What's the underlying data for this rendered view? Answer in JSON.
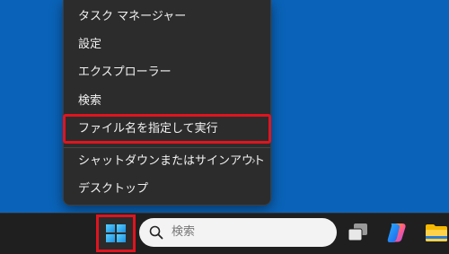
{
  "context_menu": {
    "items": [
      {
        "label": "タスク マネージャー"
      },
      {
        "label": "設定"
      },
      {
        "label": "エクスプローラー"
      },
      {
        "label": "検索"
      },
      {
        "label": "ファイル名を指定して実行"
      },
      {
        "label": "シャットダウンまたはサインアウト",
        "submenu_arrow": "›"
      },
      {
        "label": "デスクトップ"
      }
    ]
  },
  "taskbar": {
    "start_button": {
      "icon": "windows-logo-icon"
    },
    "search": {
      "placeholder": "検索",
      "icon": "search-icon"
    },
    "pinned": [
      {
        "icon": "task-view-icon"
      },
      {
        "icon": "copilot-icon"
      },
      {
        "icon": "file-explorer-icon"
      }
    ]
  },
  "colors": {
    "desktop": "#0a63b8",
    "menu_bg": "#2c2c2c",
    "taskbar_bg": "#1f1f1f",
    "highlight": "#e0141e"
  }
}
